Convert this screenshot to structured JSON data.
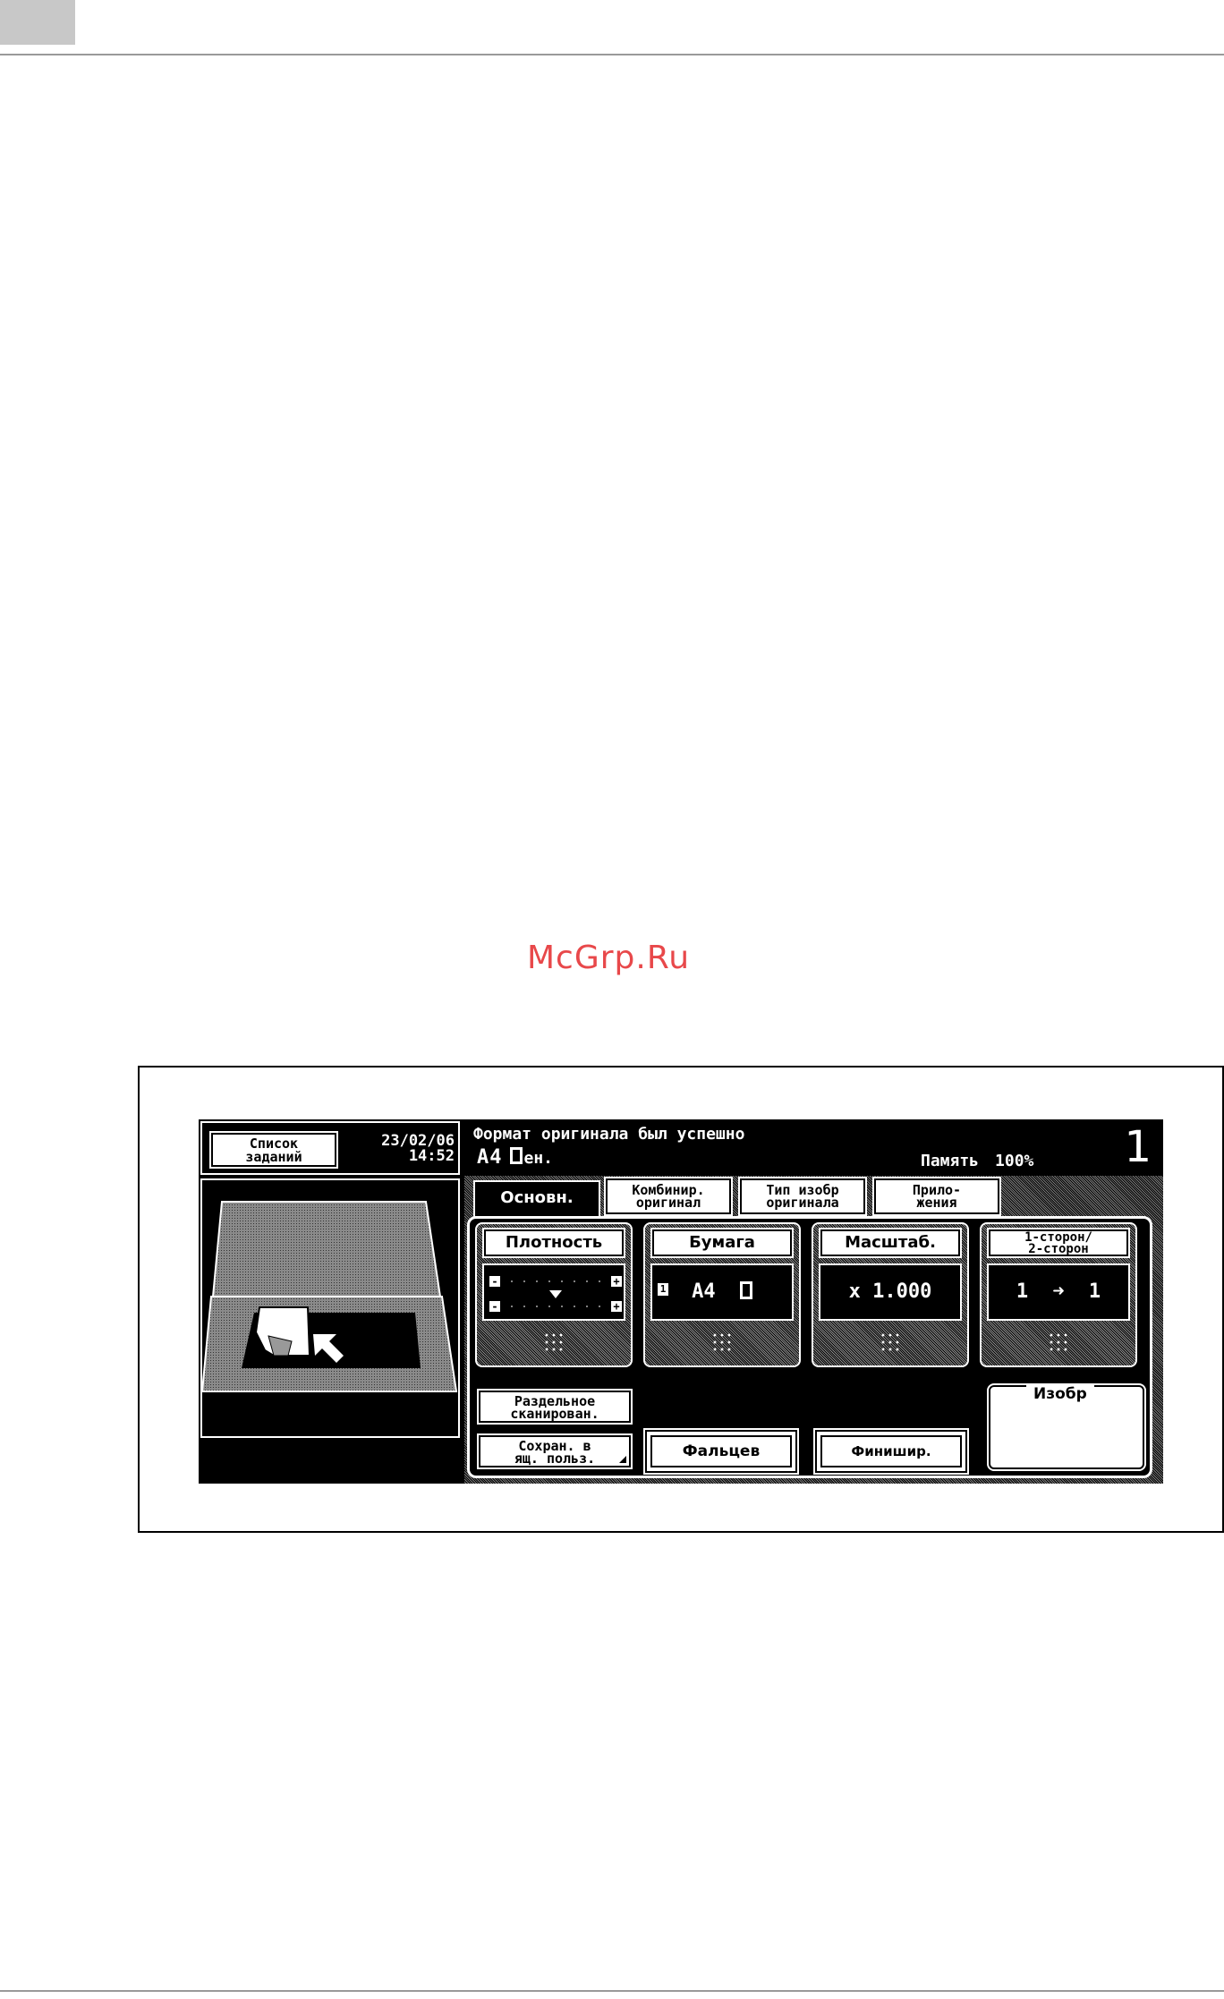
{
  "watermark": "McGrp.Ru",
  "panel": {
    "jobs_button": [
      "Список",
      "заданий"
    ],
    "date": "23/02/06",
    "time": "14:52",
    "message": "Формат оригинала был успешно",
    "original_size": "A4",
    "original_orientation_text": "ен.",
    "memory_label": "Память",
    "memory_value": "100%",
    "copies": "1",
    "tabs": [
      {
        "lines": [
          "Основн."
        ]
      },
      {
        "lines": [
          "Комбинир.",
          "оригинал"
        ]
      },
      {
        "lines": [
          "Тип изобр",
          "оригинала"
        ]
      },
      {
        "lines": [
          "Прило-",
          "жения"
        ]
      }
    ],
    "functions": {
      "density": {
        "label": "Плотность",
        "minus": "-",
        "plus": "+",
        "level_of_9": 5
      },
      "paper": {
        "label": "Бумага",
        "tray": "1",
        "value": "A4"
      },
      "zoom": {
        "label": "Масштаб.",
        "value": "x 1.000"
      },
      "duplex": {
        "label": [
          "1-сторон/",
          "2-сторон"
        ],
        "from": "1",
        "arrow": "➜",
        "to": "1"
      }
    },
    "buttons": {
      "separate_scan": [
        "Раздельное",
        "сканирован."
      ],
      "save_box": [
        "Сохран. в",
        "ящ. польз."
      ],
      "fold": "Фальцев",
      "finishing": "Финишир."
    },
    "image_box_title": "Изобр"
  },
  "colors": {
    "screen_bg": "#000000",
    "screen_fg": "#ffffff",
    "watermark": "#e8484a"
  }
}
